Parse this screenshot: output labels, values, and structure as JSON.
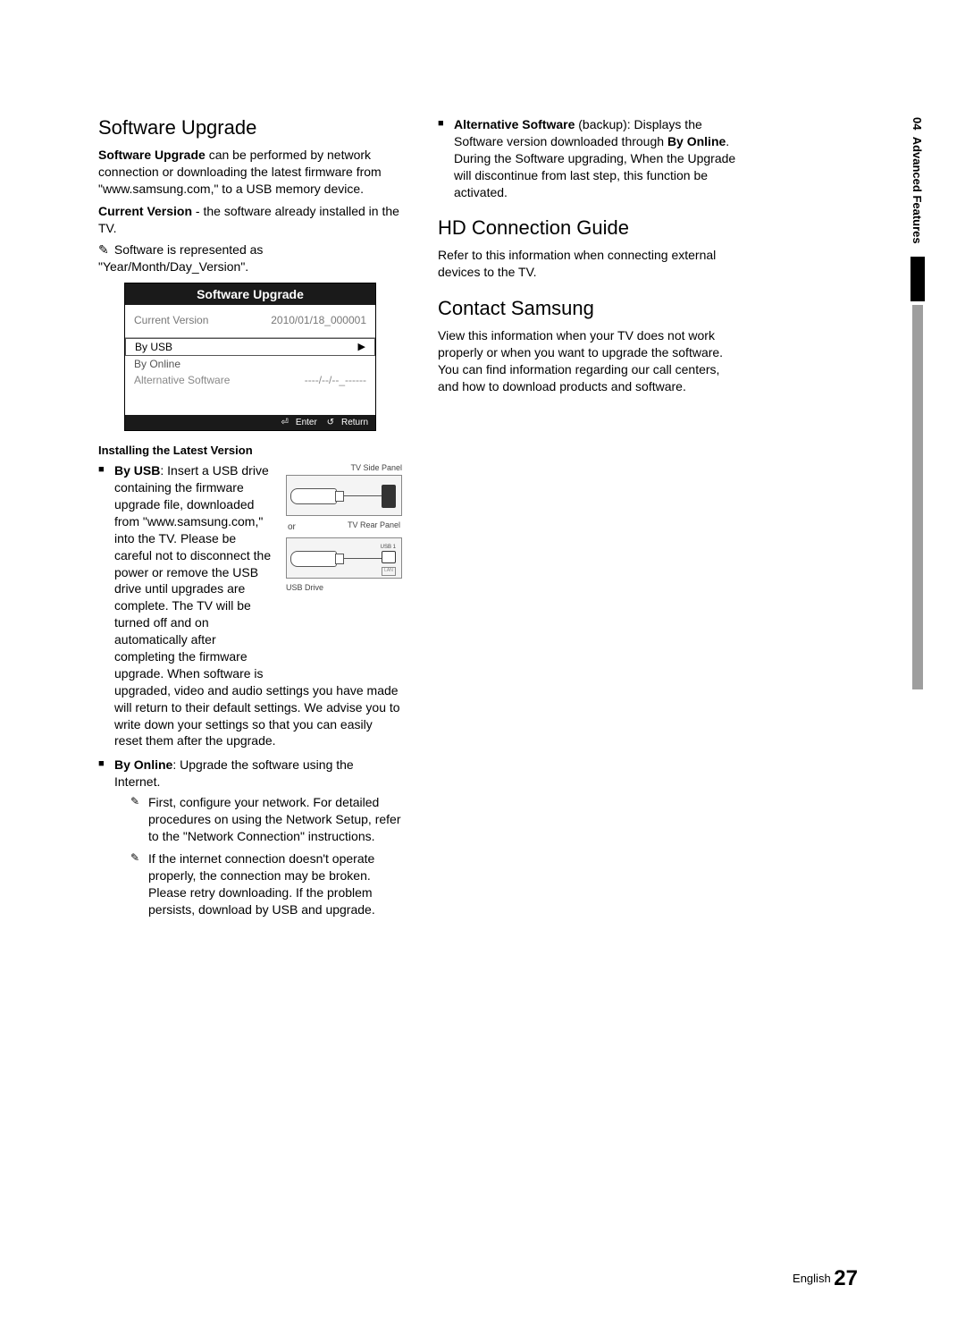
{
  "tab": {
    "number": "04",
    "label": "Advanced Features"
  },
  "left": {
    "h_software_upgrade": "Software Upgrade",
    "p1_a": "Software Upgrade",
    "p1_b": " can be performed  by network connection or downloading the latest firmware from \"www.samsung.com,\" to a USB memory device.",
    "p2_a": "Current Version",
    "p2_b": " - the software already installed in the TV.",
    "note1_icon": "✎",
    "note1": "Software is represented as \"Year/Month/Day_Version\".",
    "menu": {
      "title": "Software Upgrade",
      "row1_label": "Current Version",
      "row1_value": "2010/01/18_000001",
      "sel_label": "By USB",
      "sel_arrow": "▶",
      "item2": "By Online",
      "item3_label": "Alternative Software",
      "item3_value": "----/--/--_------",
      "footer_enter_icon": "⏎",
      "footer_enter": "Enter",
      "footer_return_icon": "↺",
      "footer_return": "Return"
    },
    "subhead_install": "Installing the Latest Version",
    "usb": {
      "label": "By USB",
      "text_before": ": Insert a USB drive containing the firmware upgrade file, downloaded from \"www.samsung.com,\" into the TV. Please be careful not to disconnect the power or remove the USB drive until upgrades are complete. The TV will be turned off and on automatically after completing the firmware upgrade. When software is ",
      "text_after": "upgraded, video and audio settings you have made will return to their default settings. We advise you to write down your settings so that you can easily reset them after the upgrade.",
      "diag_side": "TV Side Panel",
      "diag_or": "or",
      "diag_rear": "TV Rear Panel",
      "diag_drive": "USB Drive",
      "diag_usb1": "USB 1",
      "diag_lan": "LAN"
    },
    "online": {
      "label": "By Online",
      "text": ": Upgrade the software using the Internet.",
      "n1": "First, configure your network. For detailed procedures on using the Network Setup, refer to the \"Network Connection\" instructions.",
      "n2": "If the internet connection doesn't operate properly, the connection may be broken. Please retry downloading. If the problem persists, download by USB and upgrade."
    }
  },
  "right": {
    "alt_label": "Alternative Software",
    "alt_text1": " (backup): Displays the Software version downloaded through ",
    "alt_bold": "By Online",
    "alt_text2": ". During the Software upgrading, When the Upgrade will discontinue from last step, this function be activated.",
    "h_hd": "HD Connection Guide",
    "p_hd": "Refer to this information when connecting external devices to the TV.",
    "h_contact": "Contact Samsung",
    "p_contact": "View this information when your TV does not work properly or when you want to upgrade the software. You can find information regarding our call centers, and how to download products and software."
  },
  "footer": {
    "lang": "English",
    "page": "27"
  }
}
